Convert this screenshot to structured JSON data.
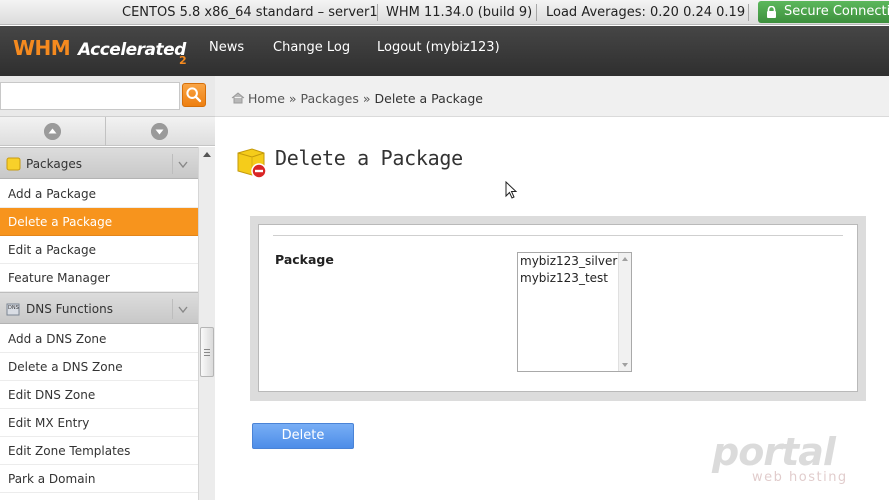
{
  "status_bar": {
    "server": "CENTOS 5.8 x86_64 standard – server1",
    "version": "WHM 11.34.0 (build 9)",
    "load": "Load Averages: 0.20 0.24 0.19",
    "secure": "Secure Connection"
  },
  "header": {
    "logo_whm": "WHM",
    "logo_accelerated": "Accelerated",
    "logo_version": "2",
    "nav": [
      "News",
      "Change Log",
      "Logout (mybiz123)"
    ]
  },
  "search": {
    "value": "",
    "placeholder": ""
  },
  "breadcrumb": {
    "home": "Home",
    "sep1": "»",
    "packages": "Packages",
    "sep2": "»",
    "current": "Delete a Package"
  },
  "sidebar": {
    "sections": [
      {
        "title": "Packages",
        "icon": "package-box-icon",
        "items": [
          "Add a Package",
          "Delete a Package",
          "Edit a Package",
          "Feature Manager"
        ],
        "active_index": 1
      },
      {
        "title": "DNS Functions",
        "icon": "dns-icon",
        "items": [
          "Add a DNS Zone",
          "Delete a DNS Zone",
          "Edit DNS Zone",
          "Edit MX Entry",
          "Edit Zone Templates",
          "Park a Domain"
        ]
      }
    ]
  },
  "page": {
    "title": "Delete a Package",
    "form_label": "Package",
    "packages": [
      "mybiz123_silver",
      "mybiz123_test"
    ],
    "button": "Delete"
  },
  "watermark": {
    "main": "portal",
    "sub": "web hosting"
  },
  "colors": {
    "accent_orange": "#f7941d",
    "button_blue": "#5b97ec",
    "header_dark": "#3a3a3a",
    "secure_green": "#4aa04a"
  }
}
